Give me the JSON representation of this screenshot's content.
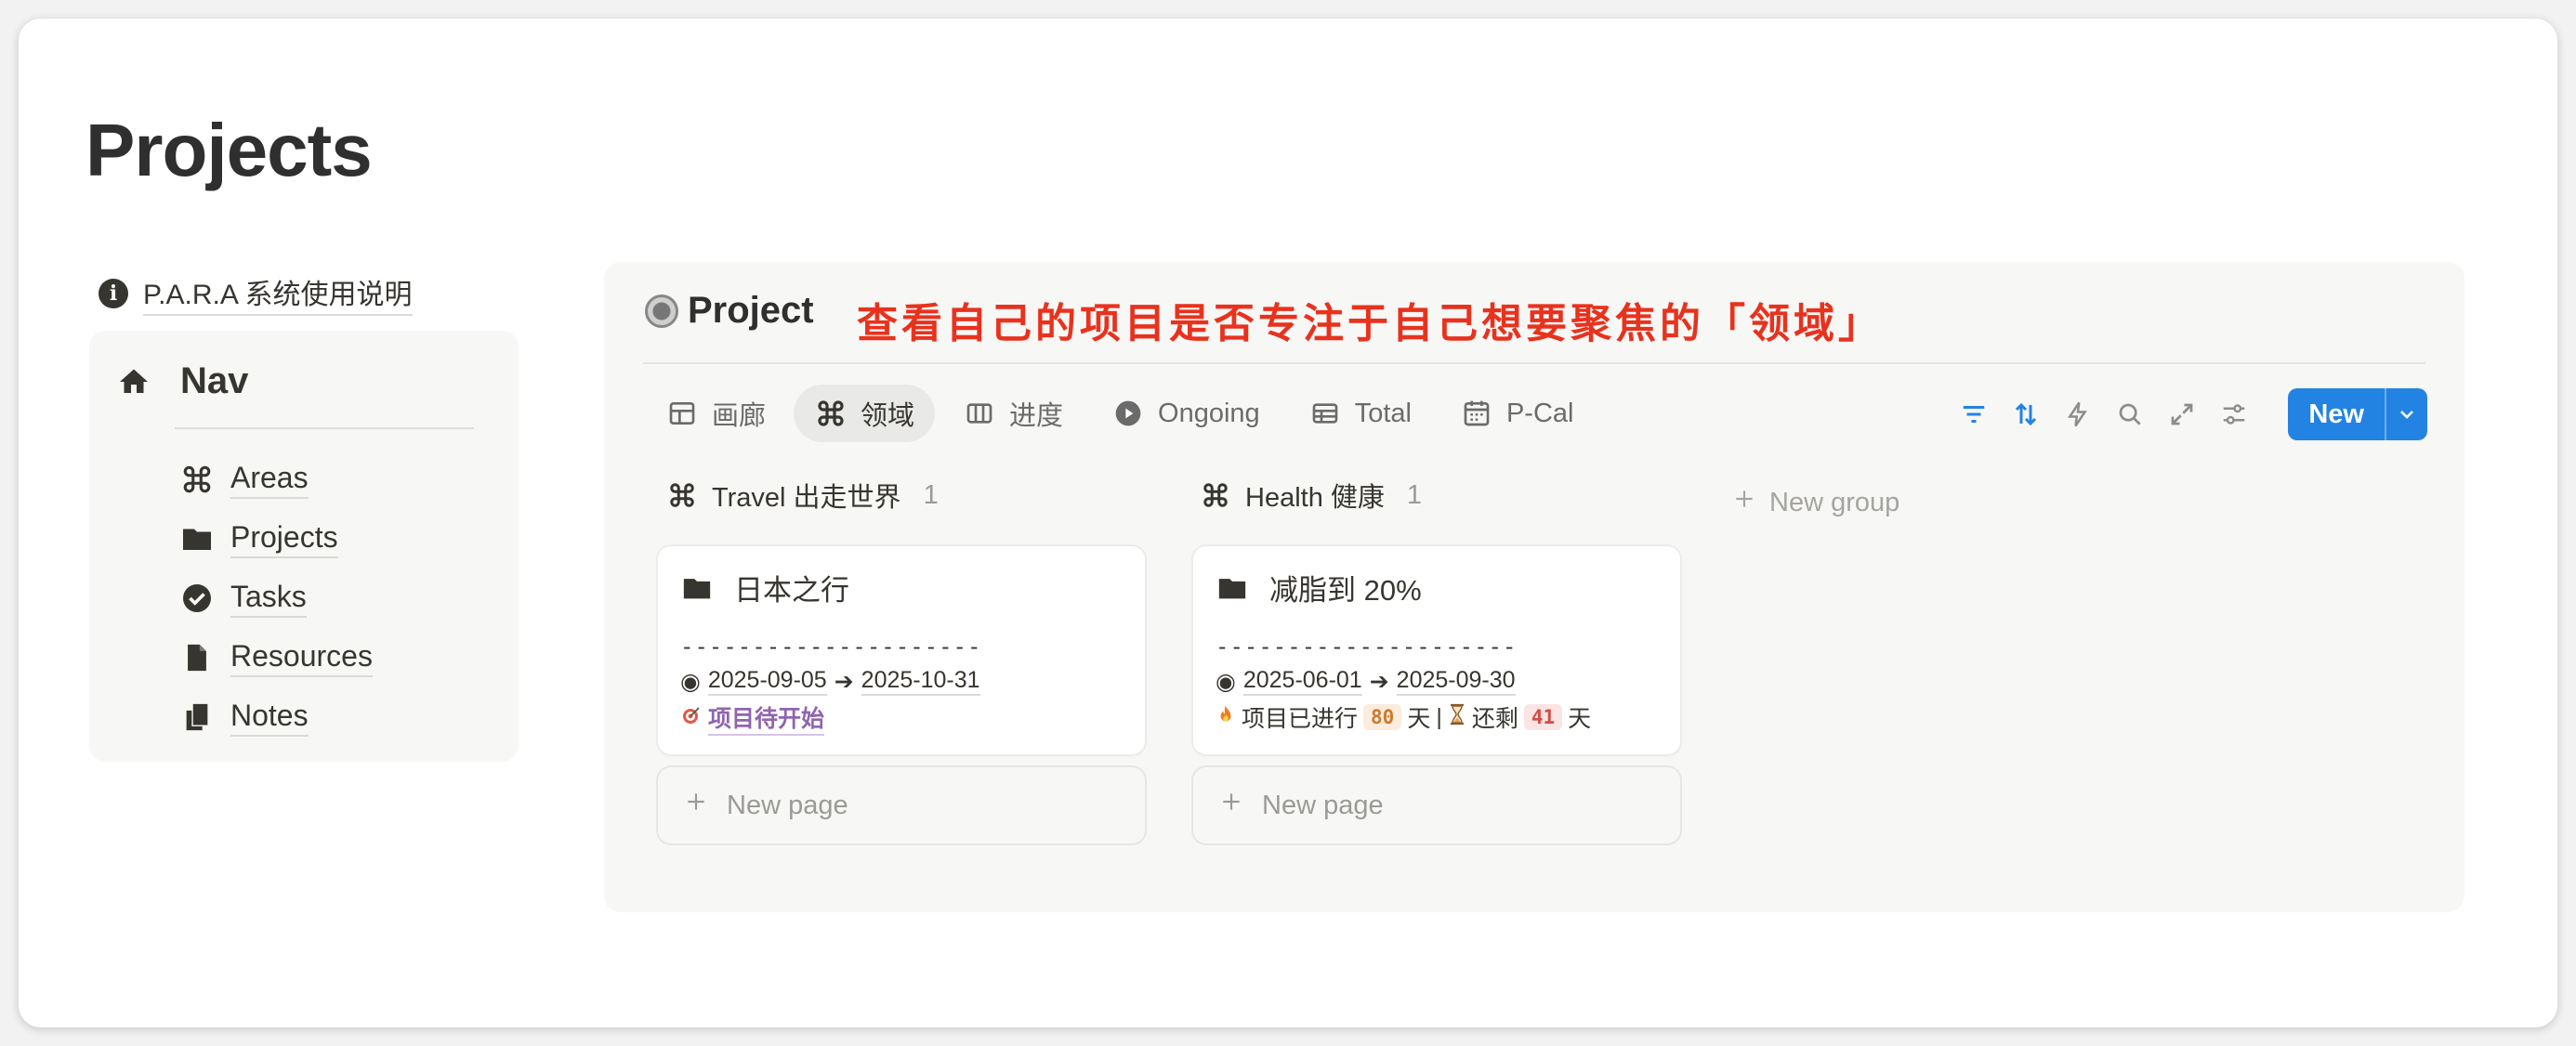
{
  "page": {
    "title": "Projects"
  },
  "info_link": {
    "label": "P.A.R.A 系统使用说明",
    "icon": "info-icon"
  },
  "nav": {
    "title": "Nav",
    "icon": "home-icon",
    "items": [
      {
        "label": "Areas",
        "icon": "command-icon"
      },
      {
        "label": "Projects",
        "icon": "folder-icon"
      },
      {
        "label": "Tasks",
        "icon": "check-circle-icon"
      },
      {
        "label": "Resources",
        "icon": "file-icon"
      },
      {
        "label": "Notes",
        "icon": "copy-icon"
      }
    ]
  },
  "database": {
    "title": "Project",
    "annotation": "查看自己的项目是否专注于自己想要聚焦的「领域」",
    "tabs": [
      {
        "label": "画廊",
        "icon": "gallery-icon",
        "active": false
      },
      {
        "label": "领域",
        "icon": "command-icon",
        "active": true
      },
      {
        "label": "进度",
        "icon": "board-icon",
        "active": false
      },
      {
        "label": "Ongoing",
        "icon": "play-circle-icon",
        "active": false
      },
      {
        "label": "Total",
        "icon": "table-icon",
        "active": false
      },
      {
        "label": "P-Cal",
        "icon": "calendar-icon",
        "active": false
      }
    ],
    "toolbar": {
      "new_label": "New",
      "accent": "#2383e2"
    },
    "groups": [
      {
        "name": "Travel 出走世界",
        "count": "1",
        "card": {
          "title": "日本之行",
          "dash": "---------------------",
          "start": "2025-09-05",
          "end": "2025-10-31",
          "status": "项目待开始"
        },
        "new_page": "New page"
      },
      {
        "name": "Health 健康",
        "count": "1",
        "card": {
          "title": "减脂到 20%",
          "dash": "---------------------",
          "start": "2025-06-01",
          "end": "2025-09-30",
          "progress_prefix": "项目已进行",
          "elapsed": "80",
          "day_unit": "天",
          "separator": "|",
          "remaining_prefix": "还剩",
          "remaining": "41",
          "day_unit2": "天"
        },
        "new_page": "New page"
      }
    ],
    "new_group": "New group"
  }
}
